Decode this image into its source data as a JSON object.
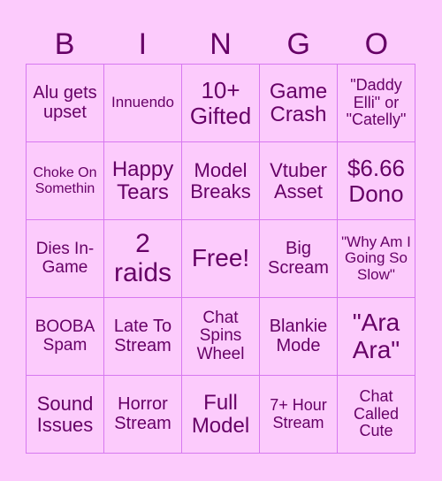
{
  "header": {
    "letters": [
      "B",
      "I",
      "N",
      "G",
      "O"
    ]
  },
  "colors": {
    "background": "#fccbfc",
    "text": "#660066",
    "grid": "#d778f0"
  },
  "board": {
    "cells": [
      "Alu gets upset",
      "Innuendo",
      "10+ Gifted",
      "Game Crash",
      "\"Daddy Elli\" or \"Catelly\"",
      "Choke On Somethin",
      "Happy Tears",
      "Model Breaks",
      "Vtuber Asset",
      "$6.66 Dono",
      "Dies In-Game",
      "2 raids",
      "Free!",
      "Big Scream",
      "\"Why Am I Going So Slow\"",
      "BOOBA Spam",
      "Late To Stream",
      "Chat Spins Wheel",
      "Blankie Mode",
      "\"Ara Ara\"",
      "Sound Issues",
      "Horror Stream",
      "Full Model",
      "7+ Hour Stream",
      "Chat Called Cute"
    ]
  }
}
